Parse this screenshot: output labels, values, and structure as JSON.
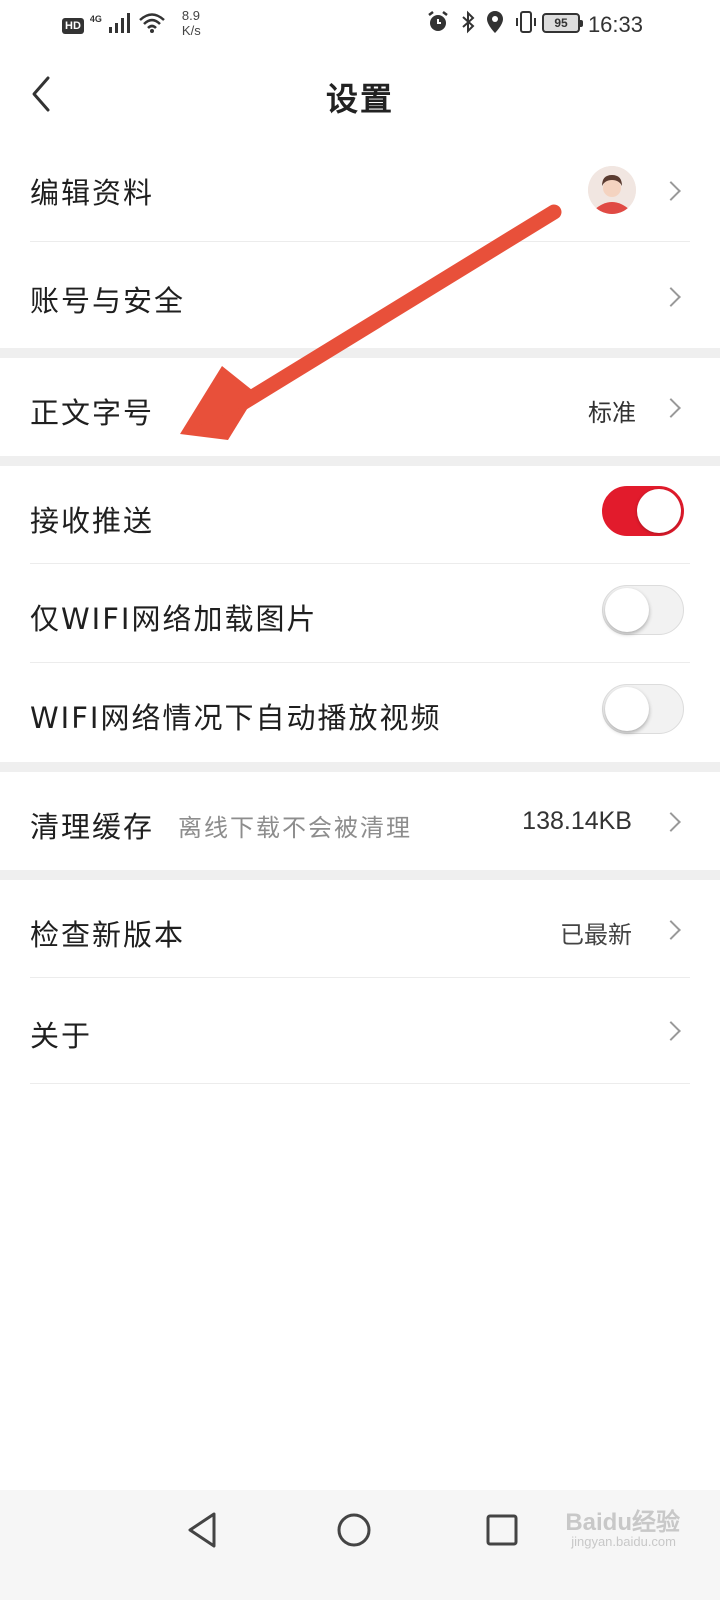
{
  "status_bar": {
    "hd": "HD",
    "network": "4G",
    "speed_value": "8.9",
    "speed_unit": "K/s",
    "battery": "95",
    "time": "16:33"
  },
  "header": {
    "title": "设置"
  },
  "rows": {
    "edit_profile": {
      "label": "编辑资料"
    },
    "account_security": {
      "label": "账号与安全"
    },
    "font_size": {
      "label": "正文字号",
      "value": "标准"
    },
    "push": {
      "label": "接收推送",
      "enabled": true
    },
    "wifi_images": {
      "label": "仅WIFI网络加载图片",
      "enabled": false
    },
    "wifi_autoplay": {
      "label": "WIFI网络情况下自动播放视频",
      "enabled": false
    },
    "clear_cache": {
      "label": "清理缓存",
      "hint": "离线下载不会被清理",
      "value": "138.14KB"
    },
    "check_update": {
      "label": "检查新版本",
      "value": "已最新"
    },
    "about": {
      "label": "关于"
    }
  },
  "watermark": {
    "text": "Baidu经验",
    "sub": "jingyan.baidu.com"
  },
  "colors": {
    "toggle_on": "#e21b2c",
    "annotation_arrow": "#e8503a"
  }
}
